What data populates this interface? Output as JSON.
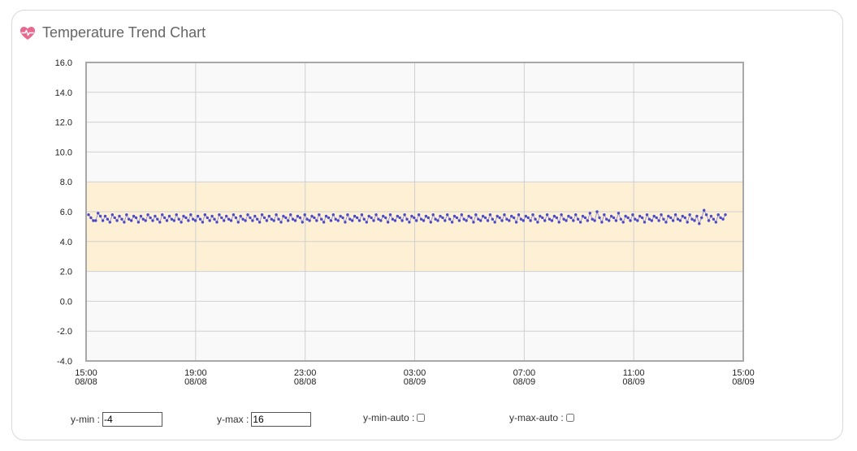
{
  "header": {
    "title": "Temperature Trend Chart",
    "icon": "heart-pulse-icon",
    "icon_color": "#e8698f"
  },
  "controls": {
    "ymin_label": "y-min :",
    "ymin_value": "-4",
    "ymax_label": "y-max :",
    "ymax_value": "16",
    "ymin_auto_label": "y-min-auto :",
    "ymax_auto_label": "y-max-auto :"
  },
  "chart_data": {
    "type": "scatter",
    "ylim": [
      -4,
      16
    ],
    "yticks": [
      "16.0",
      "14.0",
      "12.0",
      "10.0",
      "8.0",
      "6.0",
      "4.0",
      "2.0",
      "0.0",
      "-2.0",
      "-4.0"
    ],
    "xlim": [
      "2023-08-08 15:00",
      "2023-08-09 15:00"
    ],
    "xticks": [
      {
        "time": "15:00",
        "date": "08/08"
      },
      {
        "time": "19:00",
        "date": "08/08"
      },
      {
        "time": "23:00",
        "date": "08/08"
      },
      {
        "time": "03:00",
        "date": "08/09"
      },
      {
        "time": "07:00",
        "date": "08/09"
      },
      {
        "time": "11:00",
        "date": "08/09"
      },
      {
        "time": "15:00",
        "date": "08/09"
      }
    ],
    "band": {
      "from": 2,
      "to": 8,
      "color": "#fdf0d5"
    },
    "grid": true,
    "point_color": "#4a4ac8",
    "series": [
      {
        "values": [
          5.8,
          5.6,
          5.4,
          5.4,
          5.9,
          5.7,
          5.4,
          5.7,
          5.5,
          5.3,
          5.8,
          5.6,
          5.4,
          5.7,
          5.5,
          5.3,
          5.8,
          5.5,
          5.4,
          5.7,
          5.6,
          5.3,
          5.7,
          5.5,
          5.4,
          5.8,
          5.6,
          5.4,
          5.7,
          5.5,
          5.3,
          5.8,
          5.6,
          5.4,
          5.7,
          5.5,
          5.4,
          5.8,
          5.5,
          5.3,
          5.7,
          5.6,
          5.4,
          5.8,
          5.5,
          5.4,
          5.7,
          5.5,
          5.3,
          5.8,
          5.6,
          5.4,
          5.7,
          5.5,
          5.3,
          5.8,
          5.6,
          5.4,
          5.7,
          5.5,
          5.4,
          5.8,
          5.6,
          5.3,
          5.7,
          5.5,
          5.4,
          5.8,
          5.6,
          5.4,
          5.7,
          5.5,
          5.3,
          5.8,
          5.6,
          5.4,
          5.7,
          5.5,
          5.4,
          5.8,
          5.5,
          5.3,
          5.7,
          5.6,
          5.4,
          5.8,
          5.5,
          5.4,
          5.7,
          5.6,
          5.3,
          5.8,
          5.5,
          5.4,
          5.7,
          5.6,
          5.4,
          5.8,
          5.5,
          5.3,
          5.7,
          5.6,
          5.4,
          5.8,
          5.5,
          5.4,
          5.7,
          5.6,
          5.3,
          5.8,
          5.5,
          5.4,
          5.7,
          5.6,
          5.4,
          5.8,
          5.5,
          5.3,
          5.7,
          5.6,
          5.4,
          5.8,
          5.5,
          5.4,
          5.7,
          5.6,
          5.3,
          5.8,
          5.5,
          5.4,
          5.7,
          5.6,
          5.4,
          5.8,
          5.5,
          5.3,
          5.7,
          5.6,
          5.4,
          5.8,
          5.5,
          5.4,
          5.7,
          5.6,
          5.3,
          5.8,
          5.5,
          5.4,
          5.7,
          5.6,
          5.4,
          5.8,
          5.5,
          5.3,
          5.7,
          5.6,
          5.4,
          5.8,
          5.5,
          5.4,
          5.7,
          5.6,
          5.3,
          5.8,
          5.5,
          5.4,
          5.7,
          5.6,
          5.4,
          5.8,
          5.5,
          5.3,
          5.7,
          5.6,
          5.4,
          5.8,
          5.5,
          5.4,
          5.7,
          5.6,
          5.3,
          5.8,
          5.5,
          5.4,
          5.7,
          5.6,
          5.4,
          5.8,
          5.5,
          5.3,
          5.7,
          5.6,
          5.4,
          5.8,
          5.5,
          5.4,
          5.7,
          5.6,
          5.3,
          5.8,
          5.5,
          5.4,
          5.7,
          5.6,
          5.4,
          5.8,
          5.5,
          5.3,
          5.7,
          5.6,
          5.4,
          5.9,
          5.5,
          5.4,
          6.0,
          5.6,
          5.3,
          5.8,
          5.5,
          5.4,
          5.7,
          5.6,
          5.4,
          5.9,
          5.5,
          5.3,
          5.7,
          5.6,
          5.4,
          5.8,
          5.5,
          5.4,
          5.7,
          5.6,
          5.3,
          5.8,
          5.5,
          5.4,
          5.7,
          5.6,
          5.4,
          5.8,
          5.5,
          5.3,
          5.7,
          5.6,
          5.4,
          5.8,
          5.5,
          5.4,
          5.7,
          5.6,
          5.3,
          5.8,
          5.5,
          5.4,
          5.7,
          5.2,
          5.6,
          6.1,
          5.8,
          5.4,
          5.7,
          5.5,
          5.3,
          5.8,
          5.6,
          5.5,
          5.8
        ]
      }
    ]
  }
}
